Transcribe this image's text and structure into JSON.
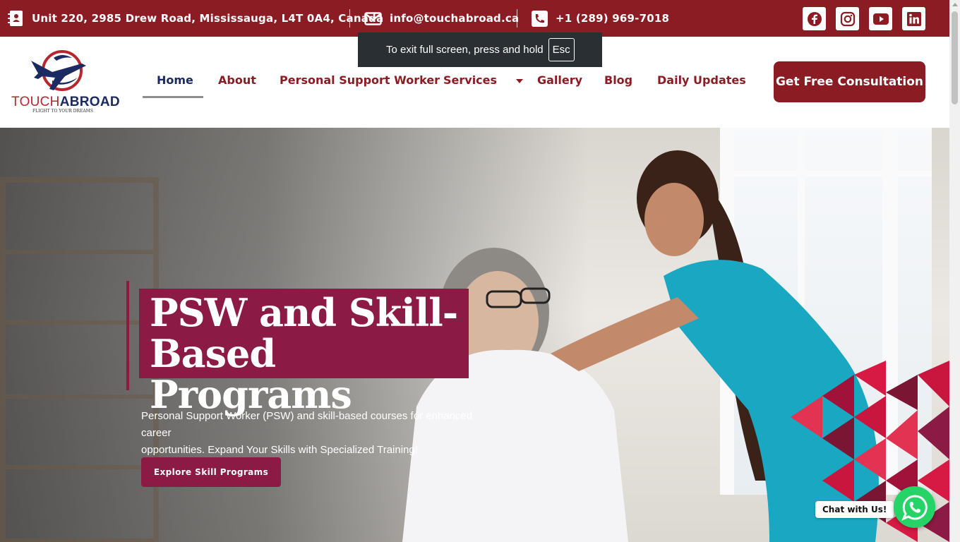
{
  "topbar": {
    "address": "Unit 220, 2985 Drew Road, Mississauga, L4T 0A4, Canada",
    "email": "info@touchabroad.ca",
    "phone": "+1 (289) 969-7018",
    "socials": [
      "facebook-icon",
      "instagram-icon",
      "youtube-icon",
      "linkedin-icon"
    ],
    "bg_color": "#8b1c23"
  },
  "fullscreen_notice": {
    "text": "To exit full screen, press and hold",
    "key": "Esc"
  },
  "logo": {
    "word_part1": "TOUCH",
    "word_part2": "ABROAD",
    "tagline": "FLIGHT TO YOUR DREAMS"
  },
  "nav": {
    "items": [
      "Home",
      "About",
      "Personal Support Worker",
      "Services",
      "Gallery",
      "Blog",
      "Daily Updates"
    ],
    "active": "Home",
    "cta": "Get Free Consultation"
  },
  "hero": {
    "title_line1": "PSW and Skill-",
    "title_line2": "Based Programs",
    "subtitle_line1": "Personal Support Worker (PSW) and skill-based courses for enhanced career",
    "subtitle_line2": "opportunities. Expand Your Skills with Specialized Training!",
    "button": "Explore Skill Programs",
    "accent_color": "#8b1a45"
  },
  "chat": {
    "label": "Chat with Us!",
    "icon": "whatsapp-icon",
    "color": "#25d366"
  }
}
